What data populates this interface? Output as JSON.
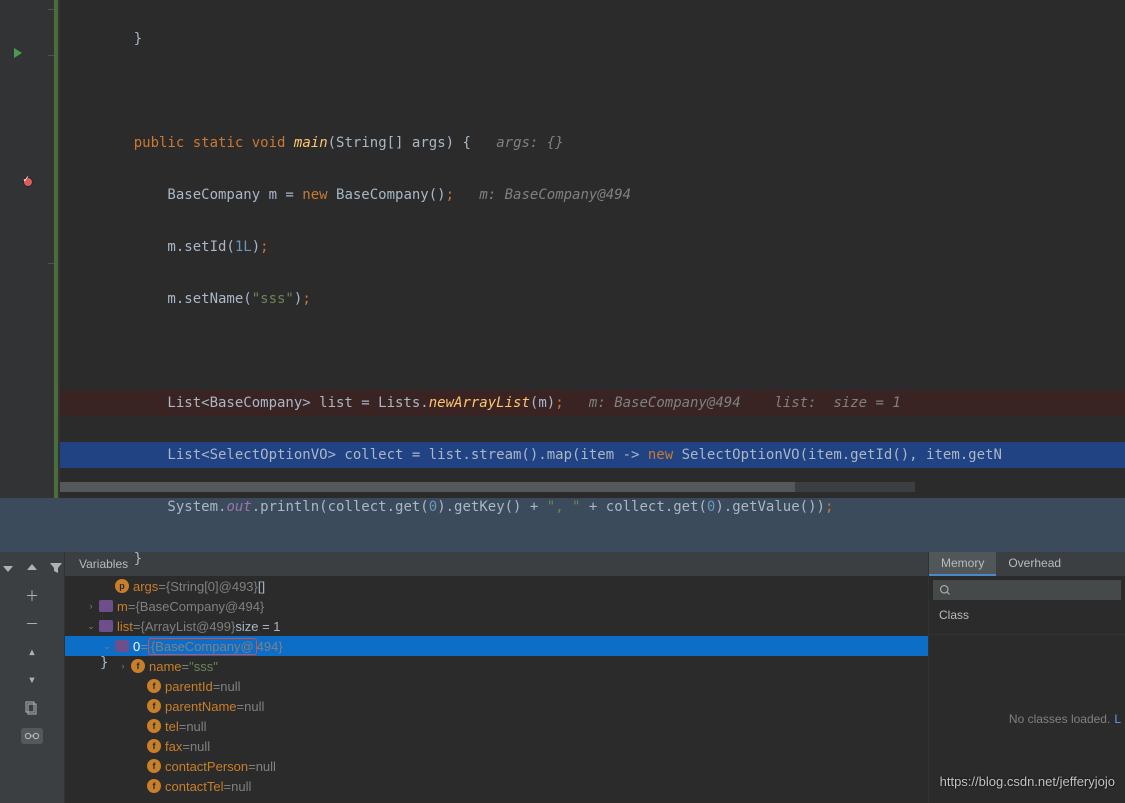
{
  "code": {
    "l1": "    }",
    "l2": "",
    "l3_kw1": "public",
    "l3_kw2": "static",
    "l3_kw3": "void",
    "l3_fn": "main",
    "l3_rest": "(String[] args) {",
    "l3_cmt": "   args: {}",
    "l4_a": "        BaseCompany m = ",
    "l4_kw": "new",
    "l4_b": " BaseCompany()",
    "l4_sc": ";",
    "l4_cmt": "   m: BaseCompany@494",
    "l5_a": "        m.setId(",
    "l5_n": "1L",
    "l5_b": ")",
    "l5_sc": ";",
    "l6_a": "        m.setName(",
    "l6_s": "\"sss\"",
    "l6_b": ")",
    "l6_sc": ";",
    "l7": "",
    "l8_a": "        List<BaseCompany> list = Lists.",
    "l8_fn": "newArrayList",
    "l8_b": "(m)",
    "l8_sc": ";",
    "l8_cmt": "   m: BaseCompany@494    list:  size = 1",
    "l9_a": "        List<SelectOptionVO> collect = list.stream().map(item -> ",
    "l9_kw": "new",
    "l9_b": " SelectOptionVO(item.getId(), item.getN",
    "l10_a": "        System.",
    "l10_st": "out",
    "l10_b": ".println(collect.get(",
    "l10_n1": "0",
    "l10_c": ").getKey() + ",
    "l10_s": "\", \"",
    "l10_d": " + collect.get(",
    "l10_n2": "0",
    "l10_e": ").getValue())",
    "l10_sc": ";",
    "l11": "    }",
    "l12": "",
    "l13": "}"
  },
  "vars_header": "Variables",
  "vars": [
    {
      "pad": 36,
      "arrow": "",
      "icon": "p",
      "name": "args",
      "eq": " = ",
      "val": "{String[0]@493}",
      "extra": " []",
      "sel": false
    },
    {
      "pad": 20,
      "arrow": "›",
      "icon": "o",
      "name": "m",
      "eq": " = ",
      "val": "{BaseCompany@494}",
      "extra": "",
      "sel": false
    },
    {
      "pad": 20,
      "arrow": "⌄",
      "icon": "o",
      "name": "list",
      "eq": " = ",
      "val": "{ArrayList@499}",
      "extra": "  size = 1",
      "sel": false
    },
    {
      "pad": 36,
      "arrow": "⌄",
      "icon": "o",
      "name": "0",
      "eq": " = ",
      "val": "{BaseCompany@494}",
      "extra": "",
      "sel": true,
      "boxed": true
    },
    {
      "pad": 52,
      "arrow": "›",
      "icon": "f",
      "name": "name",
      "eq": " = ",
      "val": "\"sss\"",
      "extra": "",
      "str": true
    },
    {
      "pad": 68,
      "arrow": "",
      "icon": "f",
      "name": "parentId",
      "eq": " = ",
      "val": "null",
      "extra": ""
    },
    {
      "pad": 68,
      "arrow": "",
      "icon": "f",
      "name": "parentName",
      "eq": " = ",
      "val": "null",
      "extra": ""
    },
    {
      "pad": 68,
      "arrow": "",
      "icon": "f",
      "name": "tel",
      "eq": " = ",
      "val": "null",
      "extra": ""
    },
    {
      "pad": 68,
      "arrow": "",
      "icon": "f",
      "name": "fax",
      "eq": " = ",
      "val": "null",
      "extra": ""
    },
    {
      "pad": 68,
      "arrow": "",
      "icon": "f",
      "name": "contactPerson",
      "eq": " = ",
      "val": "null",
      "extra": ""
    },
    {
      "pad": 68,
      "arrow": "",
      "icon": "f",
      "name": "contactTel",
      "eq": " = ",
      "val": "null",
      "extra": ""
    }
  ],
  "mem": {
    "tab1": "Memory",
    "tab2": "Overhead",
    "cls": "Class",
    "nlc": "No classes loaded.",
    "link": "L"
  },
  "watermark": "https://blog.csdn.net/jefferyjojo",
  "search_ph": ""
}
